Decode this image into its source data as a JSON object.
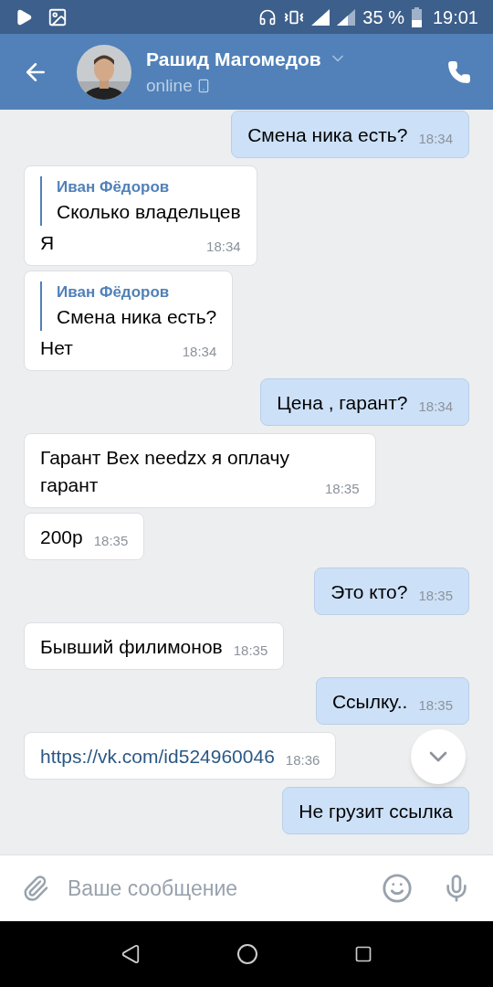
{
  "status_bar": {
    "percent": "35 %",
    "time": "19:01"
  },
  "header": {
    "name": "Рашид Магомедов",
    "status": "online"
  },
  "messages": [
    {
      "kind": "outgoing",
      "text": "Смена ника есть?",
      "time": "18:34"
    },
    {
      "kind": "incoming",
      "reply": {
        "author": "Иван Фёдоров",
        "text": "Сколько владельцев"
      },
      "text": "Я",
      "time": "18:34"
    },
    {
      "kind": "incoming",
      "reply": {
        "author": "Иван Фёдоров",
        "text": "Смена ника есть?"
      },
      "text": "Нет",
      "time": "18:34"
    },
    {
      "kind": "outgoing",
      "text": "Цена , гарант?",
      "time": "18:34"
    },
    {
      "kind": "incoming",
      "text": "Гарант Bex needzx я оплачу гарант",
      "time": "18:35"
    },
    {
      "kind": "incoming",
      "text": "200р",
      "time": "18:35"
    },
    {
      "kind": "outgoing",
      "text": "Это кто?",
      "time": "18:35"
    },
    {
      "kind": "incoming",
      "text": "Бывший филимонов",
      "time": "18:35"
    },
    {
      "kind": "outgoing",
      "text": "Ссылку..",
      "time": "18:35"
    },
    {
      "kind": "incoming",
      "link": true,
      "text": "https://vk.com/id524960046",
      "time": "18:36"
    },
    {
      "kind": "outgoing",
      "text": "Не грузит ссылка"
    }
  ],
  "composer": {
    "placeholder": "Ваше сообщение"
  }
}
